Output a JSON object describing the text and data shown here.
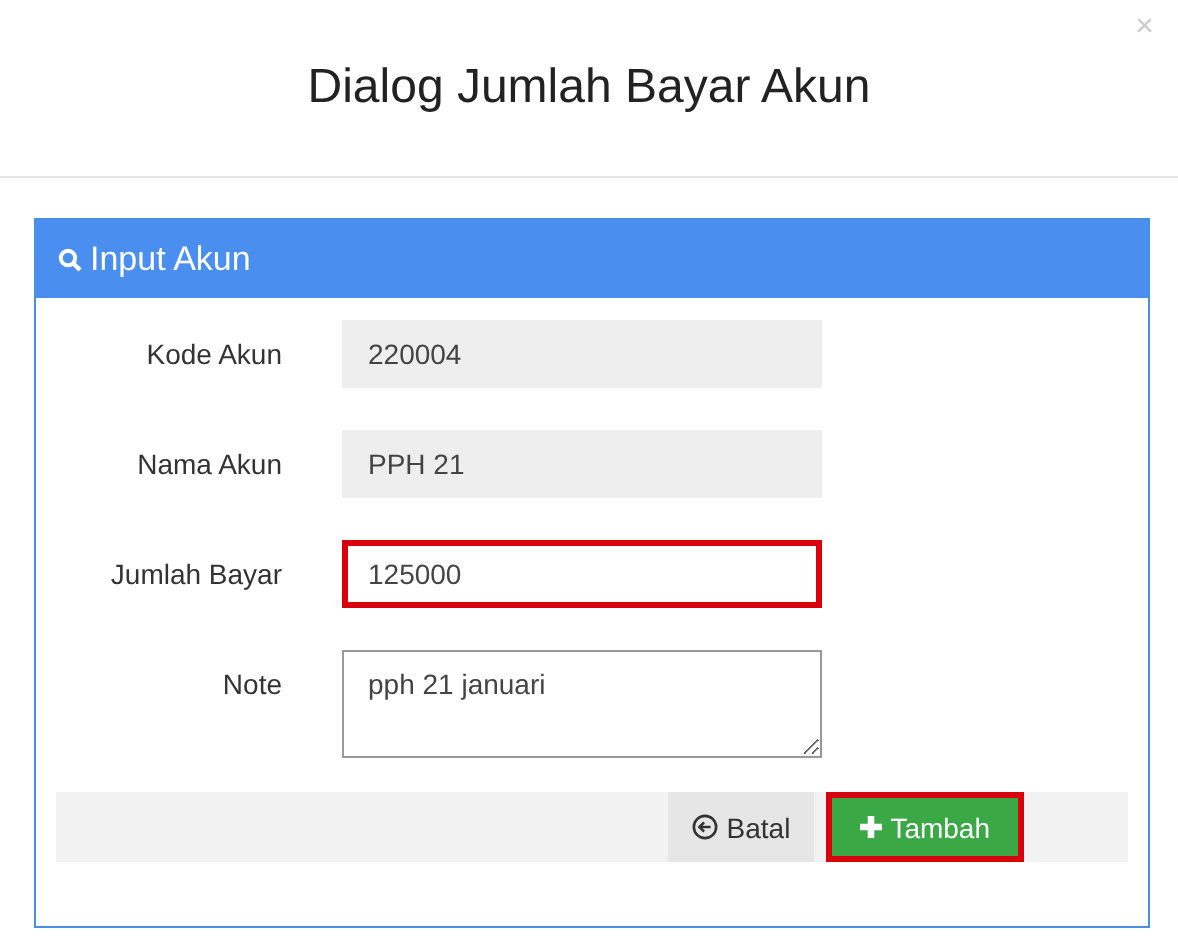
{
  "dialog": {
    "title": "Dialog Jumlah Bayar Akun",
    "close": "×"
  },
  "panel": {
    "title": "Input Akun",
    "fields": [
      {
        "label": "Kode Akun",
        "kind": "input",
        "value": "220004",
        "disabled": true,
        "highlighted": false
      },
      {
        "label": "Nama Akun",
        "kind": "input",
        "value": "PPH 21",
        "disabled": true,
        "highlighted": false
      },
      {
        "label": "Jumlah Bayar",
        "kind": "input",
        "value": "125000",
        "disabled": false,
        "highlighted": true
      },
      {
        "label": "Note",
        "kind": "textarea",
        "value": "pph 21 januari",
        "disabled": false,
        "highlighted": false
      }
    ],
    "buttons": [
      {
        "label": "Batal",
        "kind": "cancel",
        "highlighted": false
      },
      {
        "label": "Tambah",
        "kind": "add",
        "highlighted": true
      }
    ]
  }
}
